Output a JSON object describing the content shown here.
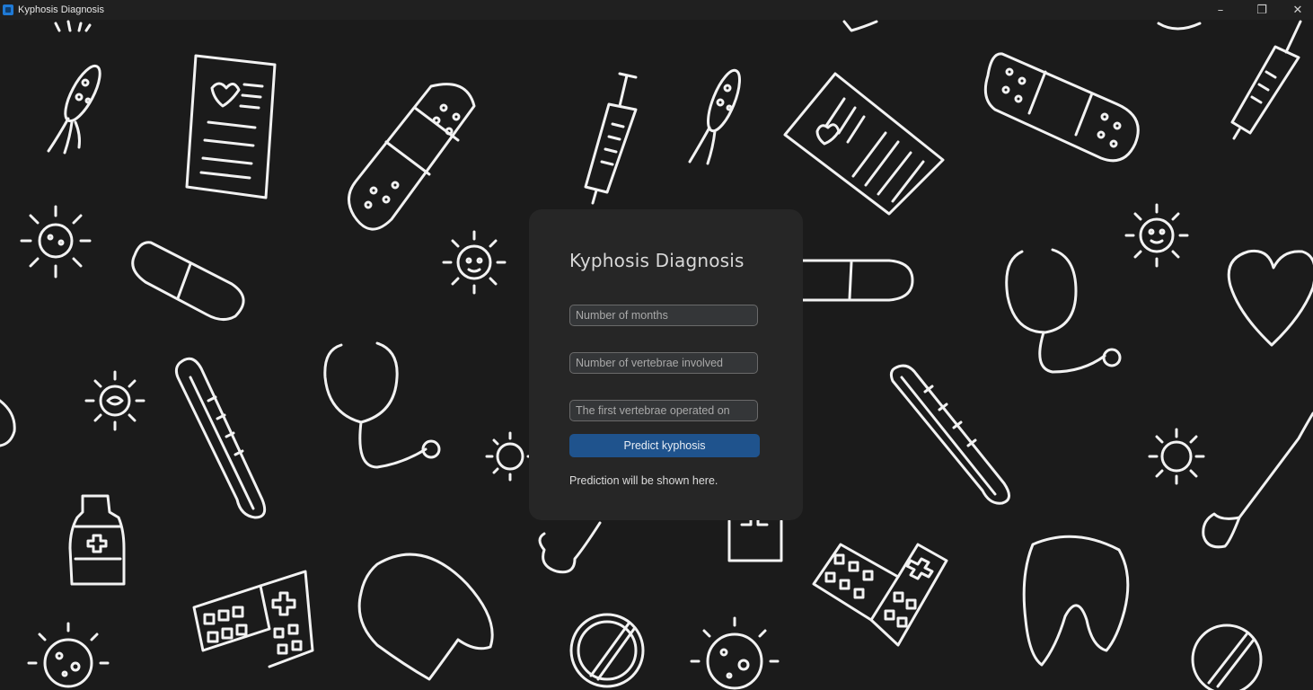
{
  "window": {
    "title": "Kyphosis Diagnosis",
    "controls": {
      "minimize": "–",
      "restore": "❐",
      "close": "✕"
    }
  },
  "form": {
    "title": "Kyphosis Diagnosis",
    "months_placeholder": "Number of months",
    "vertebrae_placeholder": "Number of vertebrae involved",
    "first_vertebra_placeholder": "The first vertebrae operated on",
    "predict_label": "Predict kyphosis",
    "result_text": "Prediction will be shown here."
  },
  "colors": {
    "background": "#1b1b1b",
    "card": "#262626",
    "button": "#1f538d",
    "doodle": "#f2f2f2"
  },
  "background_icons": [
    "bacteria-icon",
    "document-heart-icon",
    "bandage-icon",
    "syringe-icon",
    "virus-icon",
    "pill-icon",
    "thermometer-icon",
    "stethoscope-icon",
    "medicine-bottle-icon",
    "hospital-icon",
    "tooth-icon",
    "heart-icon",
    "bone-icon"
  ]
}
